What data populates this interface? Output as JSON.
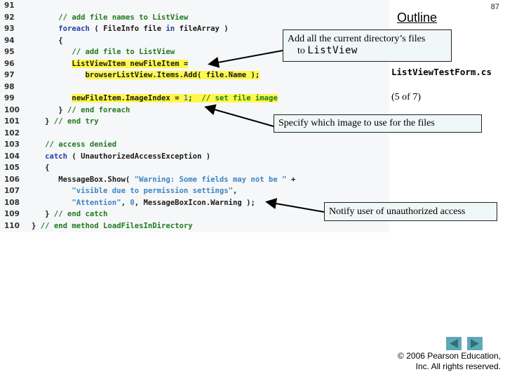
{
  "slide": {
    "page_number": "87",
    "outline_title": "Outline",
    "file_name": "ListViewTestForm.cs",
    "slide_part": "(5 of 7)"
  },
  "code": {
    "lines": [
      {
        "num": "91",
        "text": ""
      },
      {
        "num": "92",
        "text": "      // add file names to ListView"
      },
      {
        "num": "93",
        "text": "      foreach ( FileInfo file in fileArray )"
      },
      {
        "num": "94",
        "text": "      {"
      },
      {
        "num": "95",
        "text": "         // add file to ListView"
      },
      {
        "num": "96",
        "text": "         ListViewItem newFileItem ="
      },
      {
        "num": "97",
        "text": "            browserListView.Items.Add( file.Name );"
      },
      {
        "num": "98",
        "text": ""
      },
      {
        "num": "99",
        "text": "         newFileItem.ImageIndex = 1;  // set file image"
      },
      {
        "num": "100",
        "text": "      } // end foreach"
      },
      {
        "num": "101",
        "text": "   } // end try"
      },
      {
        "num": "102",
        "text": ""
      },
      {
        "num": "103",
        "text": "   // access denied"
      },
      {
        "num": "104",
        "text": "   catch ( UnauthorizedAccessException )"
      },
      {
        "num": "105",
        "text": "   {"
      },
      {
        "num": "106",
        "text": "      MessageBox.Show( \"Warning: Some fields may not be \" +"
      },
      {
        "num": "107",
        "text": "         \"visible due to permission settings\","
      },
      {
        "num": "108",
        "text": "         \"Attention\", 0, MessageBoxIcon.Warning );"
      },
      {
        "num": "109",
        "text": "   } // end catch"
      },
      {
        "num": "110",
        "text": "} // end method LoadFilesInDirectory"
      }
    ]
  },
  "callouts": {
    "add_files_text": "Add all the current directory’s files",
    "add_files_code": "ListView",
    "add_files_prefix": "to ",
    "image_text": "Specify which image to use for the files",
    "notify_text": "Notify user of unauthorized access"
  },
  "nav": {
    "prev_icon": "triangle-left",
    "next_icon": "triangle-right"
  },
  "footer": {
    "copyright_line1": "© 2006 Pearson Education,",
    "copyright_line2": "Inc.  All rights reserved."
  },
  "colors": {
    "highlight": "#fff84a",
    "keyword": "#1f3fa6",
    "comment": "#1f7a1f",
    "string": "#3a86c8",
    "nav_button": "#5fa9b6",
    "callout_bg": "#f0f7f7"
  }
}
